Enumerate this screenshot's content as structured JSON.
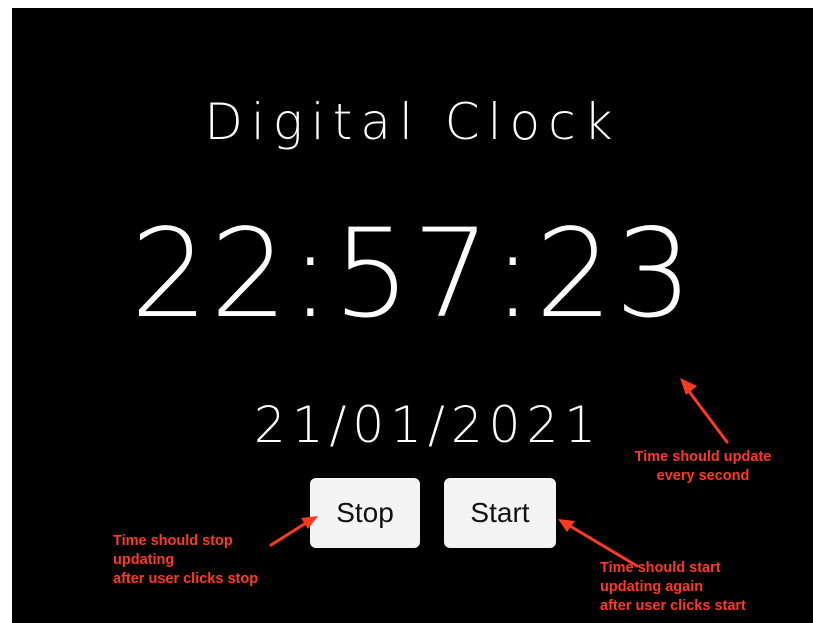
{
  "app": {
    "title": "Digital Clock",
    "time": "22:57:23",
    "date": "21/01/2021"
  },
  "buttons": {
    "stop_label": "Stop",
    "start_label": "Start"
  },
  "annotations": {
    "every_second": [
      "Time should update",
      "every second"
    ],
    "stop": [
      "Time should stop",
      "updating",
      "after user clicks stop"
    ],
    "start": [
      "Time should start",
      "updating again",
      "after user clicks start"
    ]
  },
  "colors": {
    "background": "#000000",
    "text": "#ffffff",
    "button_bg": "#f4f4f4",
    "annotation": "#ff3b1f"
  }
}
